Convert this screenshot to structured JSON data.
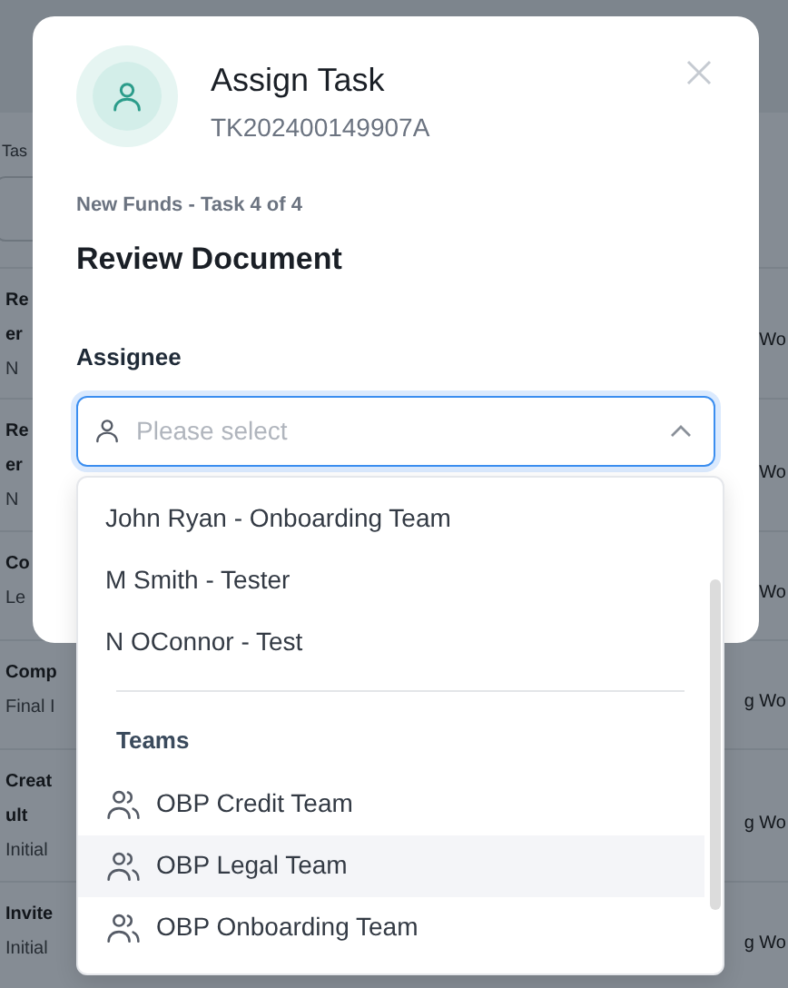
{
  "background": {
    "filter_label": "Tas",
    "rows": [
      {
        "lines": [
          "Re",
          "er",
          "N"
        ],
        "right": "Wo"
      },
      {
        "lines": [
          "Re",
          "er",
          "N"
        ],
        "right": "Wo"
      },
      {
        "lines": [
          "Co",
          "Le"
        ],
        "right": "Wo"
      },
      {
        "lines": [
          "Comp",
          "Final I"
        ],
        "right": "g Wo"
      },
      {
        "lines": [
          "Creat",
          "ult",
          "Initial"
        ],
        "right": "g Wo"
      },
      {
        "lines": [
          "Invite",
          "Initial"
        ],
        "right": "g Wo"
      }
    ]
  },
  "dialog": {
    "title": "Assign Task",
    "task_id": "TK202400149907A",
    "breadcrumb": "New Funds - Task 4 of 4",
    "heading": "Review Document",
    "assignee": {
      "label": "Assignee",
      "placeholder": "Please select",
      "expanded": true
    }
  },
  "dropdown": {
    "people": [
      {
        "label": "John Ryan - Onboarding Team",
        "highlighted": false
      },
      {
        "label": "M Smith - Tester",
        "highlighted": false
      },
      {
        "label": "N OConnor - Test",
        "highlighted": false
      }
    ],
    "teams_heading": "Teams",
    "teams": [
      {
        "label": "OBP Credit Team",
        "highlighted": false
      },
      {
        "label": "OBP Legal Team",
        "highlighted": true
      },
      {
        "label": "OBP Onboarding Team",
        "highlighted": false
      }
    ]
  }
}
